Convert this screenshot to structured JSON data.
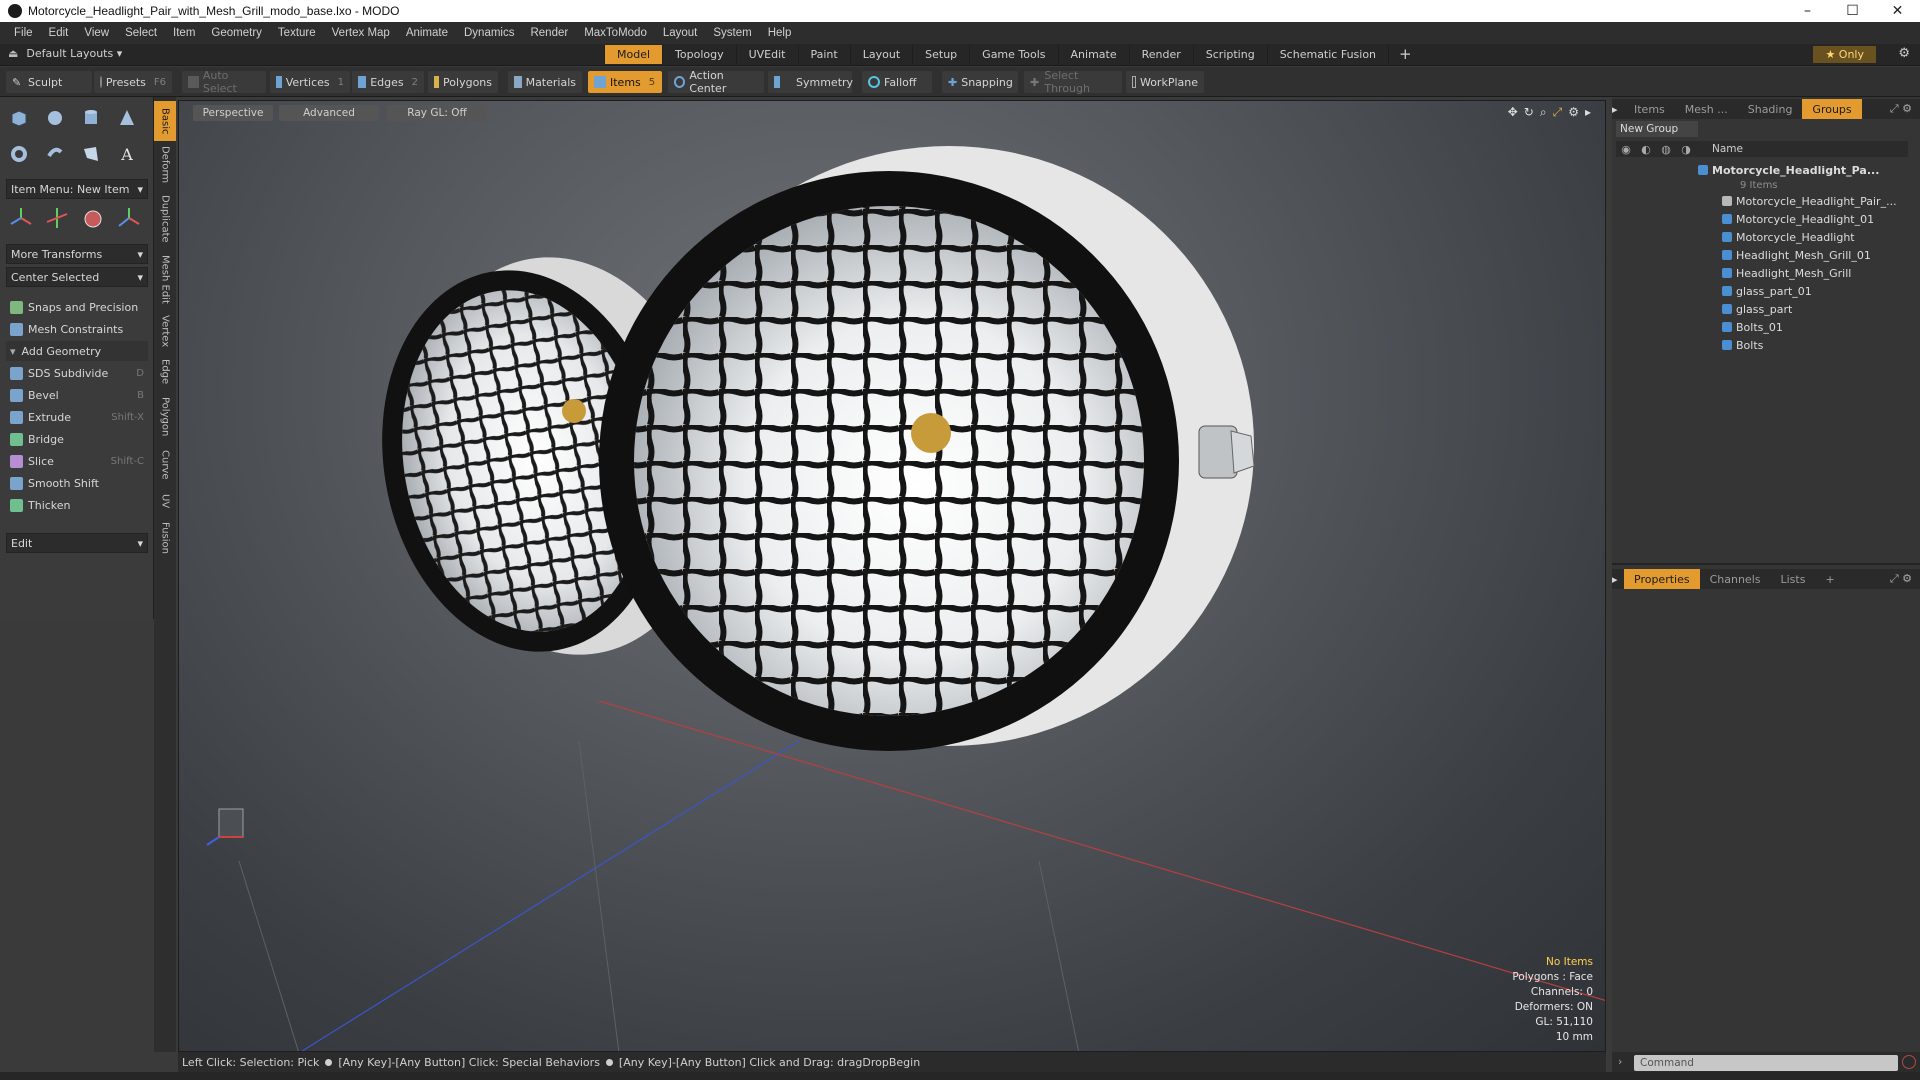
{
  "window": {
    "title": "Motorcycle_Headlight_Pair_with_Mesh_Grill_modo_base.lxo - MODO",
    "controls": [
      "–",
      "☐",
      "✕"
    ]
  },
  "menu": [
    "File",
    "Edit",
    "View",
    "Select",
    "Item",
    "Geometry",
    "Texture",
    "Vertex Map",
    "Animate",
    "Dynamics",
    "Render",
    "MaxToModo",
    "Layout",
    "System",
    "Help"
  ],
  "layoutbar": {
    "layout_name": "Default Layouts ▾",
    "tabs": [
      "Model",
      "Topology",
      "UVEdit",
      "Paint",
      "Layout",
      "Setup",
      "Game Tools",
      "Animate",
      "Render",
      "Scripting",
      "Schematic Fusion"
    ],
    "active_tab": "Model",
    "add": "+",
    "only": "★ Only"
  },
  "toolbar": {
    "sculpt": "Sculpt",
    "presets": "Presets",
    "presets_key": "F6",
    "auto_select": "Auto Select",
    "vertices": "Vertices",
    "vertices_key": "1",
    "edges": "Edges",
    "edges_key": "2",
    "polygons": "Polygons",
    "materials": "Materials",
    "items": "Items",
    "items_key": "5",
    "action_center": "Action Center",
    "symmetry": "Symmetry",
    "falloff": "Falloff",
    "snapping": "Snapping",
    "select_through": "Select Through",
    "workplane": "WorkPlane"
  },
  "leftpanel": {
    "item_menu": "Item Menu: New Item",
    "more_transforms": "More Transforms",
    "center_selected": "Center Selected",
    "snaps": "Snaps and Precision",
    "mesh_constraints": "Mesh Constraints",
    "add_geometry": "Add Geometry",
    "tools": [
      {
        "label": "SDS Subdivide",
        "key": "D"
      },
      {
        "label": "Bevel",
        "key": "B"
      },
      {
        "label": "Extrude",
        "key": "Shift-X"
      },
      {
        "label": "Bridge",
        "key": ""
      },
      {
        "label": "Slice",
        "key": "Shift-C"
      },
      {
        "label": "Smooth Shift",
        "key": ""
      },
      {
        "label": "Thicken",
        "key": ""
      }
    ],
    "edit": "Edit",
    "vtabs": [
      "Basic",
      "Deform",
      "Duplicate",
      "Mesh Edit",
      "Vertex",
      "Edge",
      "Polygon",
      "Curve",
      "UV",
      "Fusion"
    ]
  },
  "viewport": {
    "perspective": "Perspective",
    "advanced": "Advanced",
    "raygl": "Ray GL: Off",
    "info": {
      "no_items": "No Items",
      "polygons": "Polygons : Face",
      "channels": "Channels: 0",
      "deformers": "Deformers: ON",
      "gl": "GL: 51,110",
      "scale": "10 mm"
    }
  },
  "rightpanel": {
    "top_tabs": [
      "Items",
      "Mesh ...",
      "Shading",
      "Groups"
    ],
    "active_top_tab": "Groups",
    "new_group": "New Group",
    "name_header": "Name",
    "group_name": "Motorcycle_Headlight_Pa...",
    "group_count": "9 Items",
    "items": [
      "Motorcycle_Headlight_Pair_...",
      "Motorcycle_Headlight_01",
      "Motorcycle_Headlight",
      "Headlight_Mesh_Grill_01",
      "Headlight_Mesh_Grill",
      "glass_part_01",
      "glass_part",
      "Bolts_01",
      "Bolts"
    ],
    "bottom_tabs": [
      "Properties",
      "Channels",
      "Lists"
    ],
    "active_bottom_tab": "Properties"
  },
  "statusbar": {
    "left_click": "Left Click: Selection: Pick",
    "any_click": "[Any Key]-[Any Button] Click: Special Behaviors",
    "any_drag": "[Any Key]-[Any Button] Click and Drag: dragDropBegin"
  },
  "command": {
    "placeholder": "Command"
  },
  "colors": {
    "accent": "#e39b2f",
    "panel": "#3b3b3b",
    "mesh_icon": "#4a8fd1"
  }
}
